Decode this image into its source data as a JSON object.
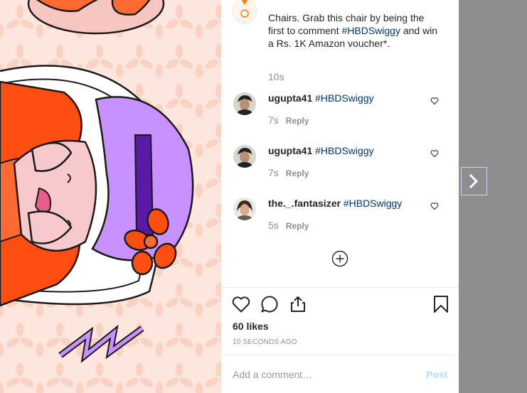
{
  "caption": {
    "avatar_icon": "swiggy-logo-icon",
    "text_prefix": "Chairs. Grab this chair by being the first to comment ",
    "hashtag": "#HBDSwiggy",
    "text_suffix": " and win a Rs. 1K Amazon voucher*.",
    "time": "10s"
  },
  "comments": [
    {
      "username": "ugupta41",
      "hashtag": "#HBDSwiggy",
      "time": "7s",
      "reply_label": "Reply"
    },
    {
      "username": "ugupta41",
      "hashtag": "#HBDSwiggy",
      "time": "7s",
      "reply_label": "Reply"
    },
    {
      "username": "the._.fantasizer",
      "hashtag": "#HBDSwiggy",
      "time": "5s",
      "reply_label": "Reply"
    }
  ],
  "actions": {
    "icons": [
      "heart-icon",
      "comment-icon",
      "share-icon",
      "bookmark-icon"
    ]
  },
  "likes": "60 likes",
  "posted": "10 SECONDS AGO",
  "comment_box": {
    "placeholder": "Add a comment…",
    "post_label": "Post"
  },
  "colors": {
    "hashtag": "#003569",
    "post_button_disabled": "#b2dffc",
    "illustration_orange": "#ff4e12",
    "illustration_purple": "#c792ff",
    "illustration_bg": "#fde6dd"
  }
}
